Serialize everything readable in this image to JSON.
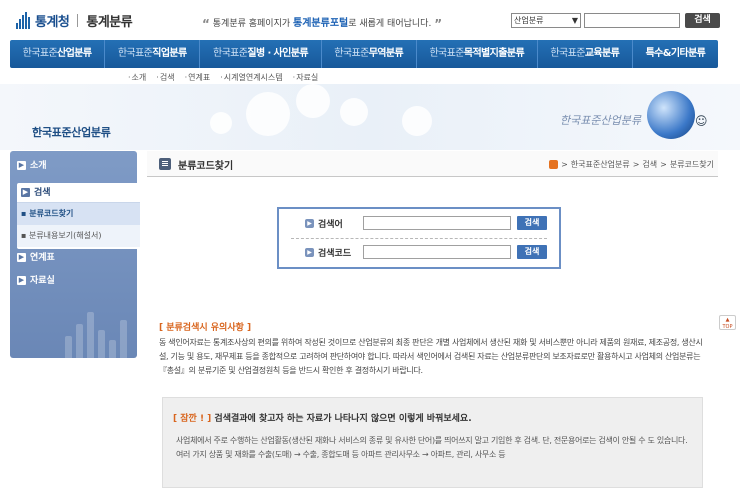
{
  "header": {
    "logo_name": "통계청",
    "logo_sub": "통계분류",
    "notice_prefix": "통계분류 홈페이지가 ",
    "notice_highlight": "통계분류포털",
    "notice_suffix": "로 새롭게 태어납니다.",
    "search_select": "산업분류",
    "search_button": "검색"
  },
  "mainnav": [
    {
      "pre": "한국표준",
      "main": "산업분류"
    },
    {
      "pre": "한국표준",
      "main": "직업분류"
    },
    {
      "pre": "한국표준",
      "main": "질병 · 사인분류"
    },
    {
      "pre": "한국표준",
      "main": "무역분류"
    },
    {
      "pre": "한국표준",
      "main": "목적별지출분류"
    },
    {
      "pre": "한국표준",
      "main": "교육분류"
    },
    {
      "pre": "",
      "main": "특수&기타분류"
    }
  ],
  "subnav": [
    "소개",
    "검색",
    "연계표",
    "시계열연계시스템",
    "자료실"
  ],
  "banner": {
    "title": "한국표준산업분류",
    "script": "한국표준산업분류"
  },
  "sidebar": {
    "intro": "소개",
    "search": "검색",
    "search_sub_1": "▪ 분류코드찾기",
    "search_sub_2": "▪ 분류내용보기(해설서)",
    "linktable": "연계표",
    "archive": "자료실"
  },
  "content": {
    "title": "분류코드찾기",
    "breadcrumb": [
      "한국표준산업분류",
      "검색",
      "분류코드찾기"
    ],
    "search_label_1": "검색어",
    "search_label_2": "검색코드",
    "search_button": "검색"
  },
  "notice": {
    "title": "[ 분류검색시 유의사항 ]",
    "body": "동 색인어자료는 통계조사상의 편의를 위하여 작성된 것이므로 산업분류의 최종 판단은 개별 사업체에서 생산된 재화 및 서비스뿐만 아니라 제품의 원재료, 제조공정, 생산시설, 기능 및 용도, 재무제표 등을 종합적으로 고려하여 판단하여야 합니다. 따라서 색인어에서 검색된 자료는 산업분류판단의 보조자료로만 활용하시고 사업체의 산업분류는 『총설』의 분류기준 및 산업결정원칙 등을 반드시 확인한 후 결정하시기 바랍니다."
  },
  "tip": {
    "tag": "[ 잠깐 ! ]",
    "title": " 검색결과에 찾고자 하는 자료가 나타나지 않으면 이렇게 바꿔보세요.",
    "body": "사업체에서 주로 수행하는 산업활동(생산된 재화나 서비스의 종류 및 유사한 단어)를 띄어쓰지 말고 기입한 후 검색. 단, 전문용어로는 검색이 안될 수 도 있습니다. 여러 가지 상품 및 재화를 수출(도매) → 수출, 종합도매 등 아파트 관리사무소 → 아파트, 관리, 사무소 등"
  },
  "top_button": "TOP"
}
